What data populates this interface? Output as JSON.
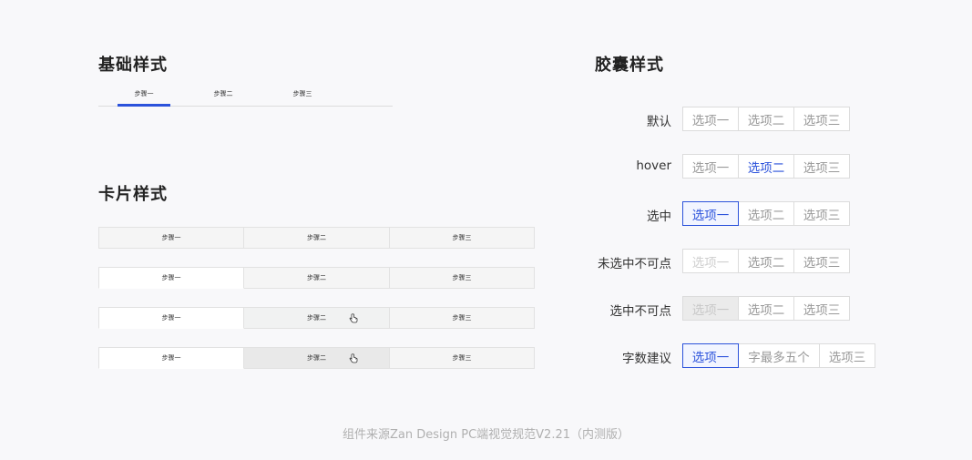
{
  "basic": {
    "title": "基础样式",
    "tabs": [
      "步骤一",
      "步骤二",
      "步骤三"
    ]
  },
  "card": {
    "title": "卡片样式",
    "rows": [
      [
        "步骤一",
        "步骤二",
        "步骤三"
      ],
      [
        "步骤一",
        "步骤二",
        "步骤三"
      ],
      [
        "步骤一",
        "步骤二",
        "步骤三"
      ],
      [
        "步骤一",
        "步骤二",
        "步骤三"
      ]
    ]
  },
  "capsule": {
    "title": "胶囊样式",
    "rows": [
      {
        "label": "默认",
        "options": [
          "选项一",
          "选项二",
          "选项三"
        ]
      },
      {
        "label": "hover",
        "options": [
          "选项一",
          "选项二",
          "选项三"
        ]
      },
      {
        "label": "选中",
        "options": [
          "选项一",
          "选项二",
          "选项三"
        ]
      },
      {
        "label": "未选中不可点",
        "options": [
          "选项一",
          "选项二",
          "选项三"
        ]
      },
      {
        "label": "选中不可点",
        "options": [
          "选项一",
          "选项二",
          "选项三"
        ]
      },
      {
        "label": "字数建议",
        "options": [
          "选项一",
          "字最多五个",
          "选项三"
        ]
      }
    ]
  },
  "footer": "组件来源Zan Design PC端视觉规范V2.21（内测版）",
  "colors": {
    "accent": "#2b52db",
    "background": "#f8f8fa",
    "border": "#dcdcdc"
  },
  "icons": {
    "cursor": "hand-pointer-icon"
  }
}
